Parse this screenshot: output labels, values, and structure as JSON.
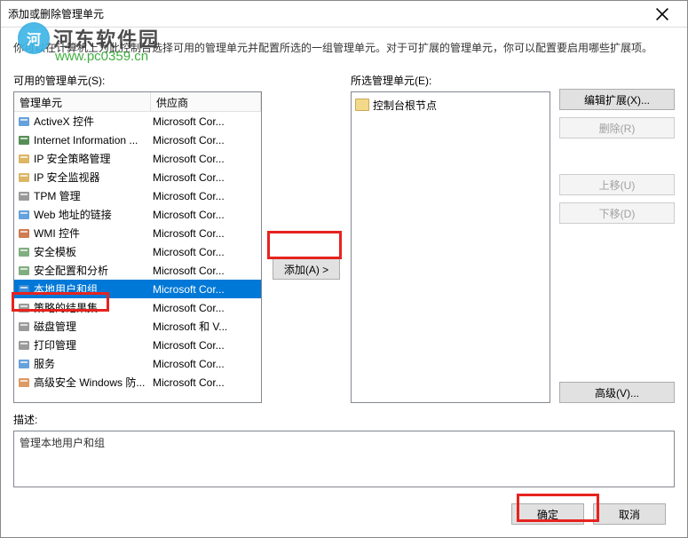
{
  "title": "添加或删除管理单元",
  "description": "你可以在计算机上为此控制台选择可用的管理单元并配置所选的一组管理单元。对于可扩展的管理单元，你可以配置要启用哪些扩展项。",
  "watermark": {
    "logo_text": "河",
    "text": "河东软件园",
    "url": "www.pc0359.cn"
  },
  "available": {
    "label": "可用的管理单元(S):",
    "columns": {
      "c1": "管理单元",
      "c2": "供应商"
    },
    "items": [
      {
        "name": "ActiveX 控件",
        "vendor": "Microsoft Cor...",
        "icon": "activex"
      },
      {
        "name": "Internet Information ...",
        "vendor": "Microsoft Cor...",
        "icon": "iis"
      },
      {
        "name": "IP 安全策略管理",
        "vendor": "Microsoft Cor...",
        "icon": "ipsec"
      },
      {
        "name": "IP 安全监视器",
        "vendor": "Microsoft Cor...",
        "icon": "ipmon"
      },
      {
        "name": "TPM 管理",
        "vendor": "Microsoft Cor...",
        "icon": "tpm"
      },
      {
        "name": "Web 地址的链接",
        "vendor": "Microsoft Cor...",
        "icon": "web"
      },
      {
        "name": "WMI 控件",
        "vendor": "Microsoft Cor...",
        "icon": "wmi"
      },
      {
        "name": "安全模板",
        "vendor": "Microsoft Cor...",
        "icon": "sectpl"
      },
      {
        "name": "安全配置和分析",
        "vendor": "Microsoft Cor...",
        "icon": "seccfg"
      },
      {
        "name": "本地用户和组",
        "vendor": "Microsoft Cor...",
        "icon": "users",
        "selected": true
      },
      {
        "name": "策略的结果集",
        "vendor": "Microsoft Cor...",
        "icon": "rsop"
      },
      {
        "name": "磁盘管理",
        "vendor": "Microsoft 和 V...",
        "icon": "disk"
      },
      {
        "name": "打印管理",
        "vendor": "Microsoft Cor...",
        "icon": "print"
      },
      {
        "name": "服务",
        "vendor": "Microsoft Cor...",
        "icon": "svc"
      },
      {
        "name": "高级安全 Windows 防...",
        "vendor": "Microsoft Cor...",
        "icon": "fw"
      }
    ]
  },
  "add_button": "添加(A) >",
  "selected": {
    "label": "所选管理单元(E):",
    "items": [
      {
        "name": "控制台根节点"
      }
    ]
  },
  "side_buttons": {
    "edit_ext": "编辑扩展(X)...",
    "remove": "删除(R)",
    "move_up": "上移(U)",
    "move_down": "下移(D)",
    "advanced": "高级(V)..."
  },
  "desc_section": {
    "label": "描述:",
    "text": "管理本地用户和组"
  },
  "footer": {
    "ok": "确定",
    "cancel": "取消"
  }
}
